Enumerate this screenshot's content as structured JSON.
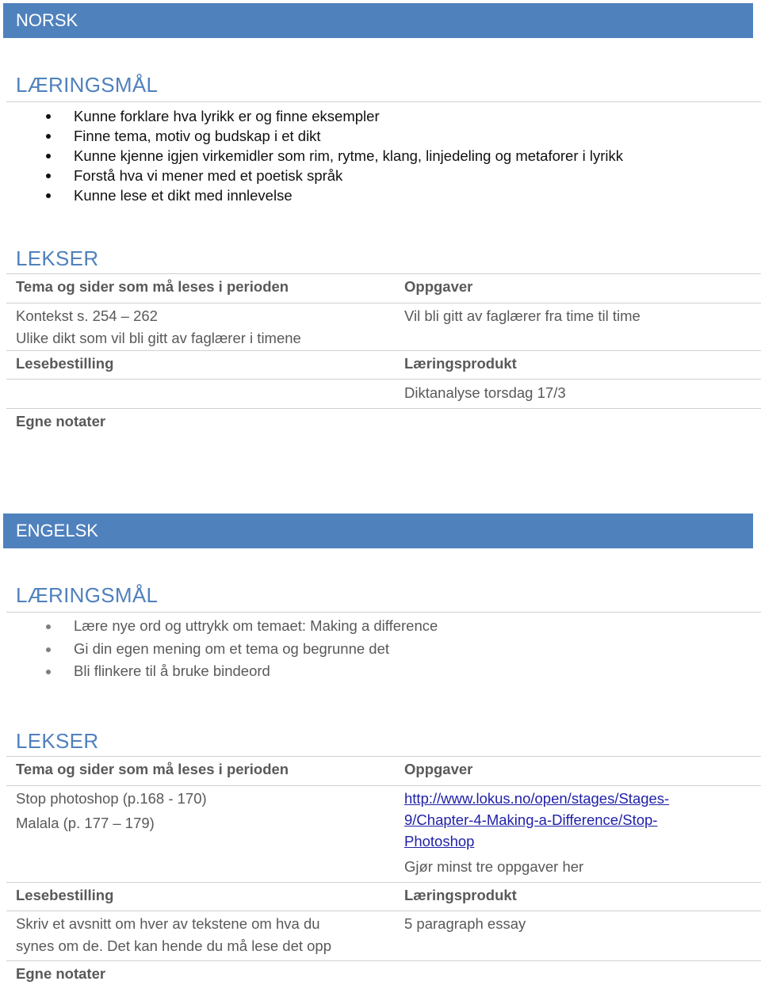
{
  "theme": {
    "accent": "#4f81bd",
    "text": "#595959",
    "rule": "#d0d0d0",
    "link": "#1f1fa8"
  },
  "norsk": {
    "title": "NORSK",
    "goals_heading": "LÆRINGSMÅL",
    "goals": [
      "Kunne forklare hva lyrikk er og finne eksempler",
      "Finne tema, motiv og budskap i et dikt",
      "Kunne kjenne igjen virkemidler som rim, rytme, klang, linjedeling og metaforer i lyrikk",
      "Forstå hva vi mener med et poetisk språk",
      "Kunne lese et dikt med innlevelse"
    ],
    "homework_heading": "LEKSER",
    "topics_label": "Tema og sider som må leses i perioden",
    "topics": [
      "Kontekst s. 254 – 262",
      "Ulike dikt som vil bli gitt av faglærer i timene"
    ],
    "tasks_label": "Oppgaver",
    "tasks": [
      "Vil bli gitt av faglærer fra time til time"
    ],
    "reading_label": "Lesebestilling",
    "reading": [],
    "product_label": "Læringsprodukt",
    "product": [
      "Diktanalyse torsdag 17/3"
    ],
    "notes_label": "Egne notater"
  },
  "engelsk": {
    "title": "ENGELSK",
    "goals_heading": "LÆRINGSMÅL",
    "goals": [
      "Lære nye ord og uttrykk om temaet: Making a difference",
      "Gi din egen mening om et tema og begrunne det",
      "Bli flinkere til å bruke bindeord"
    ],
    "homework_heading": "LEKSER",
    "topics_label": "Tema og sider som må leses i perioden",
    "topics": [
      "Stop photoshop (p.168 - 170)",
      "Malala (p. 177 – 179)"
    ],
    "tasks_label": "Oppgaver",
    "task_link": "http://www.lokus.no/open/stages/Stages-9/Chapter-4-Making-a-Difference/Stop-Photoshop",
    "task_link_lines": [
      "http://www.lokus.no/open/stages/Stages-",
      "9/Chapter-4-Making-a-Difference/Stop-",
      "Photoshop"
    ],
    "tasks": [
      "Gjør minst tre oppgaver her"
    ],
    "reading_label": "Lesebestilling",
    "reading": [
      "Skriv et avsnitt om hver av tekstene om hva du",
      "synes om de. Det kan hende du må lese det opp"
    ],
    "product_label": "Læringsprodukt",
    "product": [
      "5 paragraph essay"
    ],
    "notes_label": "Egne notater"
  }
}
